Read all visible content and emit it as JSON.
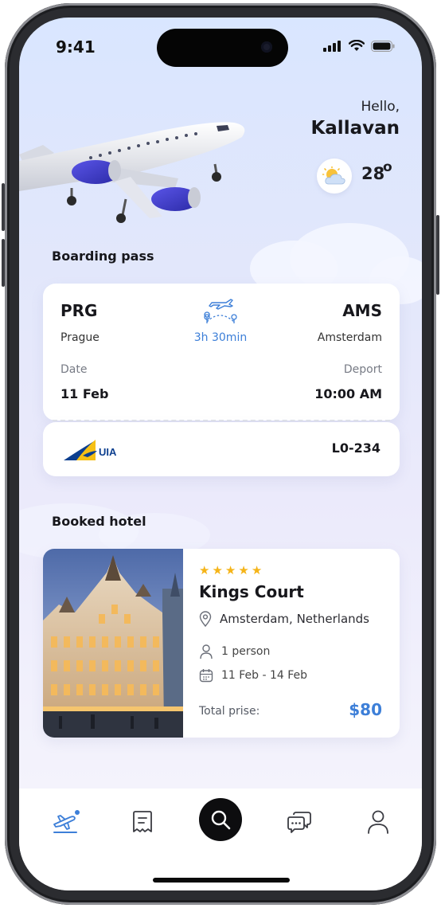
{
  "status_bar": {
    "time": "9:41"
  },
  "greeting": {
    "hello": "Hello,",
    "name": "Kallavan"
  },
  "weather": {
    "temperature": "28",
    "degree_symbol": "o",
    "icon": "partly-cloudy-icon"
  },
  "boarding_pass": {
    "section_title": "Boarding pass",
    "from_code": "PRG",
    "from_city": "Prague",
    "to_code": "AMS",
    "to_city": "Amsterdam",
    "duration": "3h 30min",
    "date_label": "Date",
    "date_value": "11 Feb",
    "depart_label": "Deport",
    "depart_value": "10:00 AM",
    "airline_logo_text": "UIA",
    "flight_number": "L0-234"
  },
  "hotel": {
    "section_title": "Booked hotel",
    "rating_stars": 5,
    "name": "Kings Court",
    "location": "Amsterdam, Netherlands",
    "guests": "1 person",
    "dates": "11 Feb - 14 Feb",
    "total_label": "Total prise:",
    "total_price": "$80"
  },
  "tab_bar": {
    "tabs": [
      "flights-icon",
      "bookings-icon",
      "search-icon",
      "messages-icon",
      "profile-icon"
    ],
    "active": "flights-icon"
  },
  "colors": {
    "accent": "#3d7fd8",
    "star": "#f5b418",
    "fab": "#0d0d0f"
  }
}
